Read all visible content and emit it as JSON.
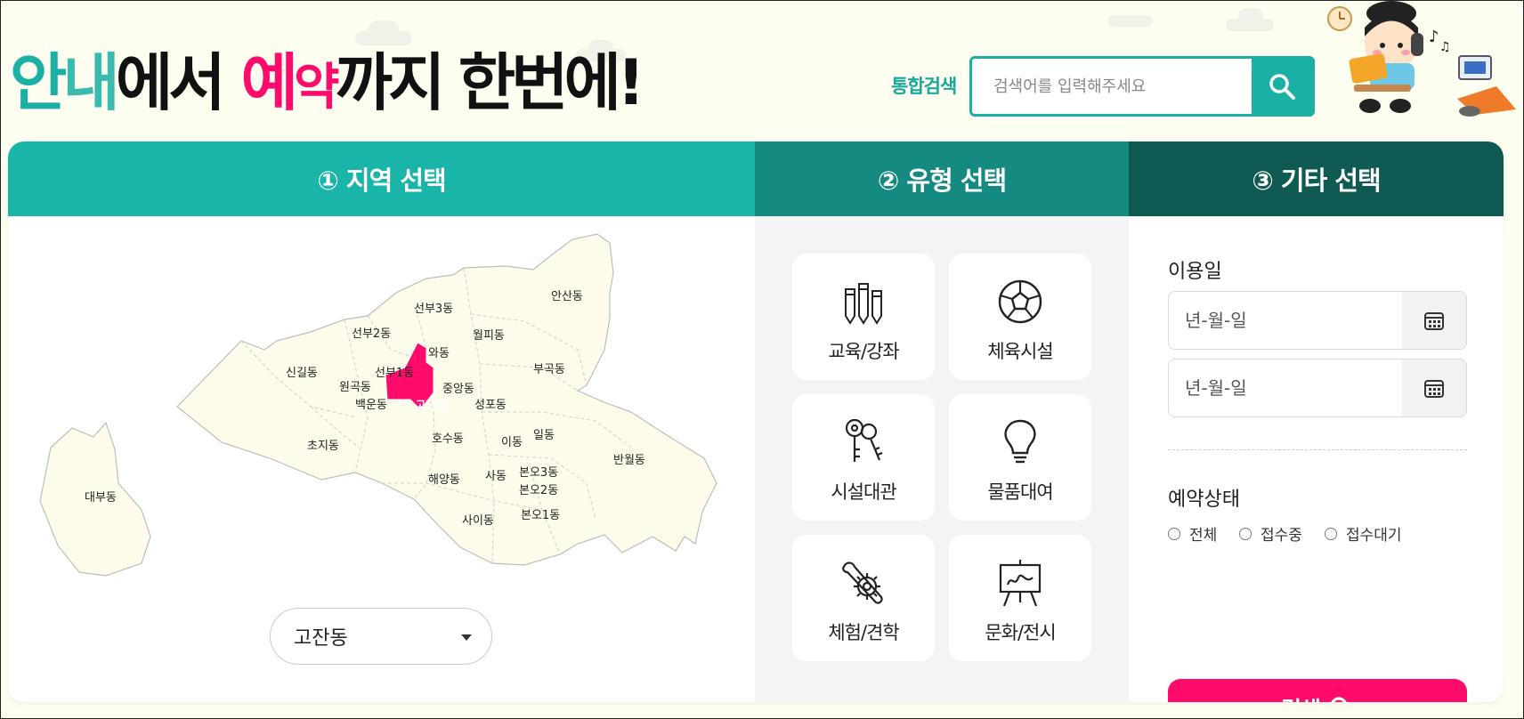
{
  "headline": {
    "part1": "안",
    "part2": "내",
    "part3": "에서",
    "part4": "예",
    "part5": "약",
    "part6": "까지 한번에!"
  },
  "search": {
    "label": "통합검색",
    "placeholder": "검색어를 입력해주세요",
    "button_icon": "search-icon"
  },
  "tabs": [
    {
      "label": "① 지역 선택"
    },
    {
      "label": "② 유형 선택"
    },
    {
      "label": "③ 기타 선택"
    }
  ],
  "map": {
    "selected": "고잔동",
    "dongs": [
      "안산동",
      "선부3동",
      "월피동",
      "선부2동",
      "와동",
      "부곡동",
      "신길동",
      "선부1동",
      "원곡동",
      "중앙동",
      "고잔동",
      "백운동",
      "성포동",
      "일동",
      "호수동",
      "이동",
      "초지동",
      "반월동",
      "해양동",
      "사동",
      "본오3동",
      "대부동",
      "본오2동",
      "본오1동",
      "사이동"
    ]
  },
  "region_select": {
    "value": "고잔동"
  },
  "categories": [
    {
      "label": "교육/강좌",
      "icon": "pencils-icon"
    },
    {
      "label": "체육시설",
      "icon": "soccer-ball-icon"
    },
    {
      "label": "시설대관",
      "icon": "keys-icon"
    },
    {
      "label": "물품대여",
      "icon": "lightbulb-icon"
    },
    {
      "label": "체험/견학",
      "icon": "wrench-gear-icon"
    },
    {
      "label": "문화/전시",
      "icon": "easel-icon"
    }
  ],
  "other": {
    "date_title": "이용일",
    "date_placeholder_start": "년-월-일",
    "date_placeholder_end": "년-월-일",
    "status_title": "예약상태",
    "status_options": [
      {
        "label": "전체"
      },
      {
        "label": "접수중"
      },
      {
        "label": "접수대기"
      }
    ],
    "submit_label": "검색"
  },
  "colors": {
    "teal": "#19b5a8",
    "teal_mid": "#148a80",
    "teal_dark": "#0f5a53",
    "pink": "#ff0b6b"
  }
}
